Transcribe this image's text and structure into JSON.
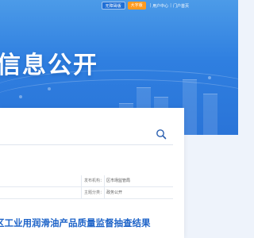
{
  "header": {
    "accessible_label": "无障碍版",
    "large_font_label": "大字版",
    "links": [
      "用户中心",
      "门户首页"
    ]
  },
  "hero": {
    "title": "信息公开"
  },
  "search": {
    "value": "",
    "placeholder": ""
  },
  "info": {
    "rows": [
      {
        "label": "发布机构：",
        "value": "区市场监管局"
      },
      {
        "label": "主题分类：",
        "value": "政务公开"
      }
    ]
  },
  "article": {
    "title": "区工业用润滑油产品质量监督抽查结果"
  },
  "colors": {
    "hero_blue": "#2f7fe0",
    "title_blue": "#1d63c8",
    "orange": "#ff9a1f"
  }
}
